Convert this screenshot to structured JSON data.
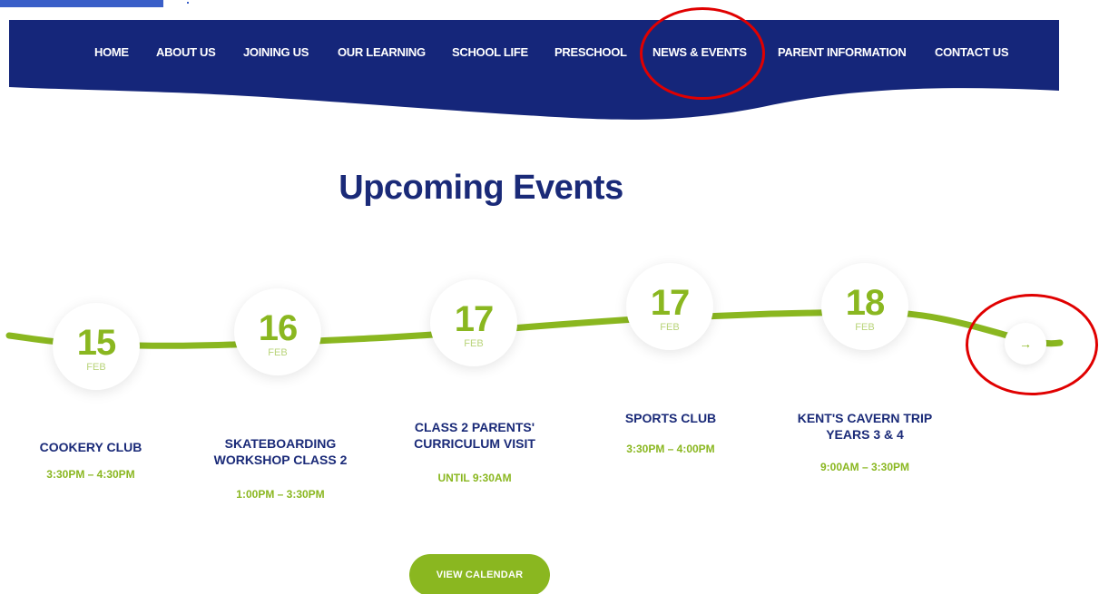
{
  "nav": {
    "items": [
      {
        "label": "HOME"
      },
      {
        "label": "ABOUT US"
      },
      {
        "label": "JOINING US"
      },
      {
        "label": "OUR LEARNING"
      },
      {
        "label": "SCHOOL LIFE"
      },
      {
        "label": "PRESCHOOL"
      },
      {
        "label": "NEWS & EVENTS"
      },
      {
        "label": "PARENT INFORMATION"
      },
      {
        "label": "CONTACT US"
      }
    ]
  },
  "events_section": {
    "title": "Upcoming Events",
    "events": [
      {
        "day": "15",
        "month": "FEB",
        "title": "COOKERY CLUB",
        "time": "3:30PM – 4:30PM"
      },
      {
        "day": "16",
        "month": "FEB",
        "title": "SKATEBOARDING WORKSHOP CLASS 2",
        "time": "1:00PM – 3:30PM"
      },
      {
        "day": "17",
        "month": "FEB",
        "title": "CLASS 2 PARENTS' CURRICULUM VISIT",
        "time": "UNTIL 9:30AM"
      },
      {
        "day": "17",
        "month": "FEB",
        "title": "SPORTS CLUB",
        "time": "3:30PM – 4:00PM"
      },
      {
        "day": "18",
        "month": "FEB",
        "title": "KENT'S CAVERN TRIP YEARS 3 & 4",
        "time": "9:00AM – 3:30PM"
      }
    ],
    "next_icon": "→",
    "view_calendar_label": "VIEW CALENDAR"
  },
  "colors": {
    "nav_bg": "#15267a",
    "title": "#1a2a78",
    "accent_green": "#8ab720",
    "annotation_red": "#e00000"
  },
  "icons": {
    "next": "arrow-right-icon"
  }
}
